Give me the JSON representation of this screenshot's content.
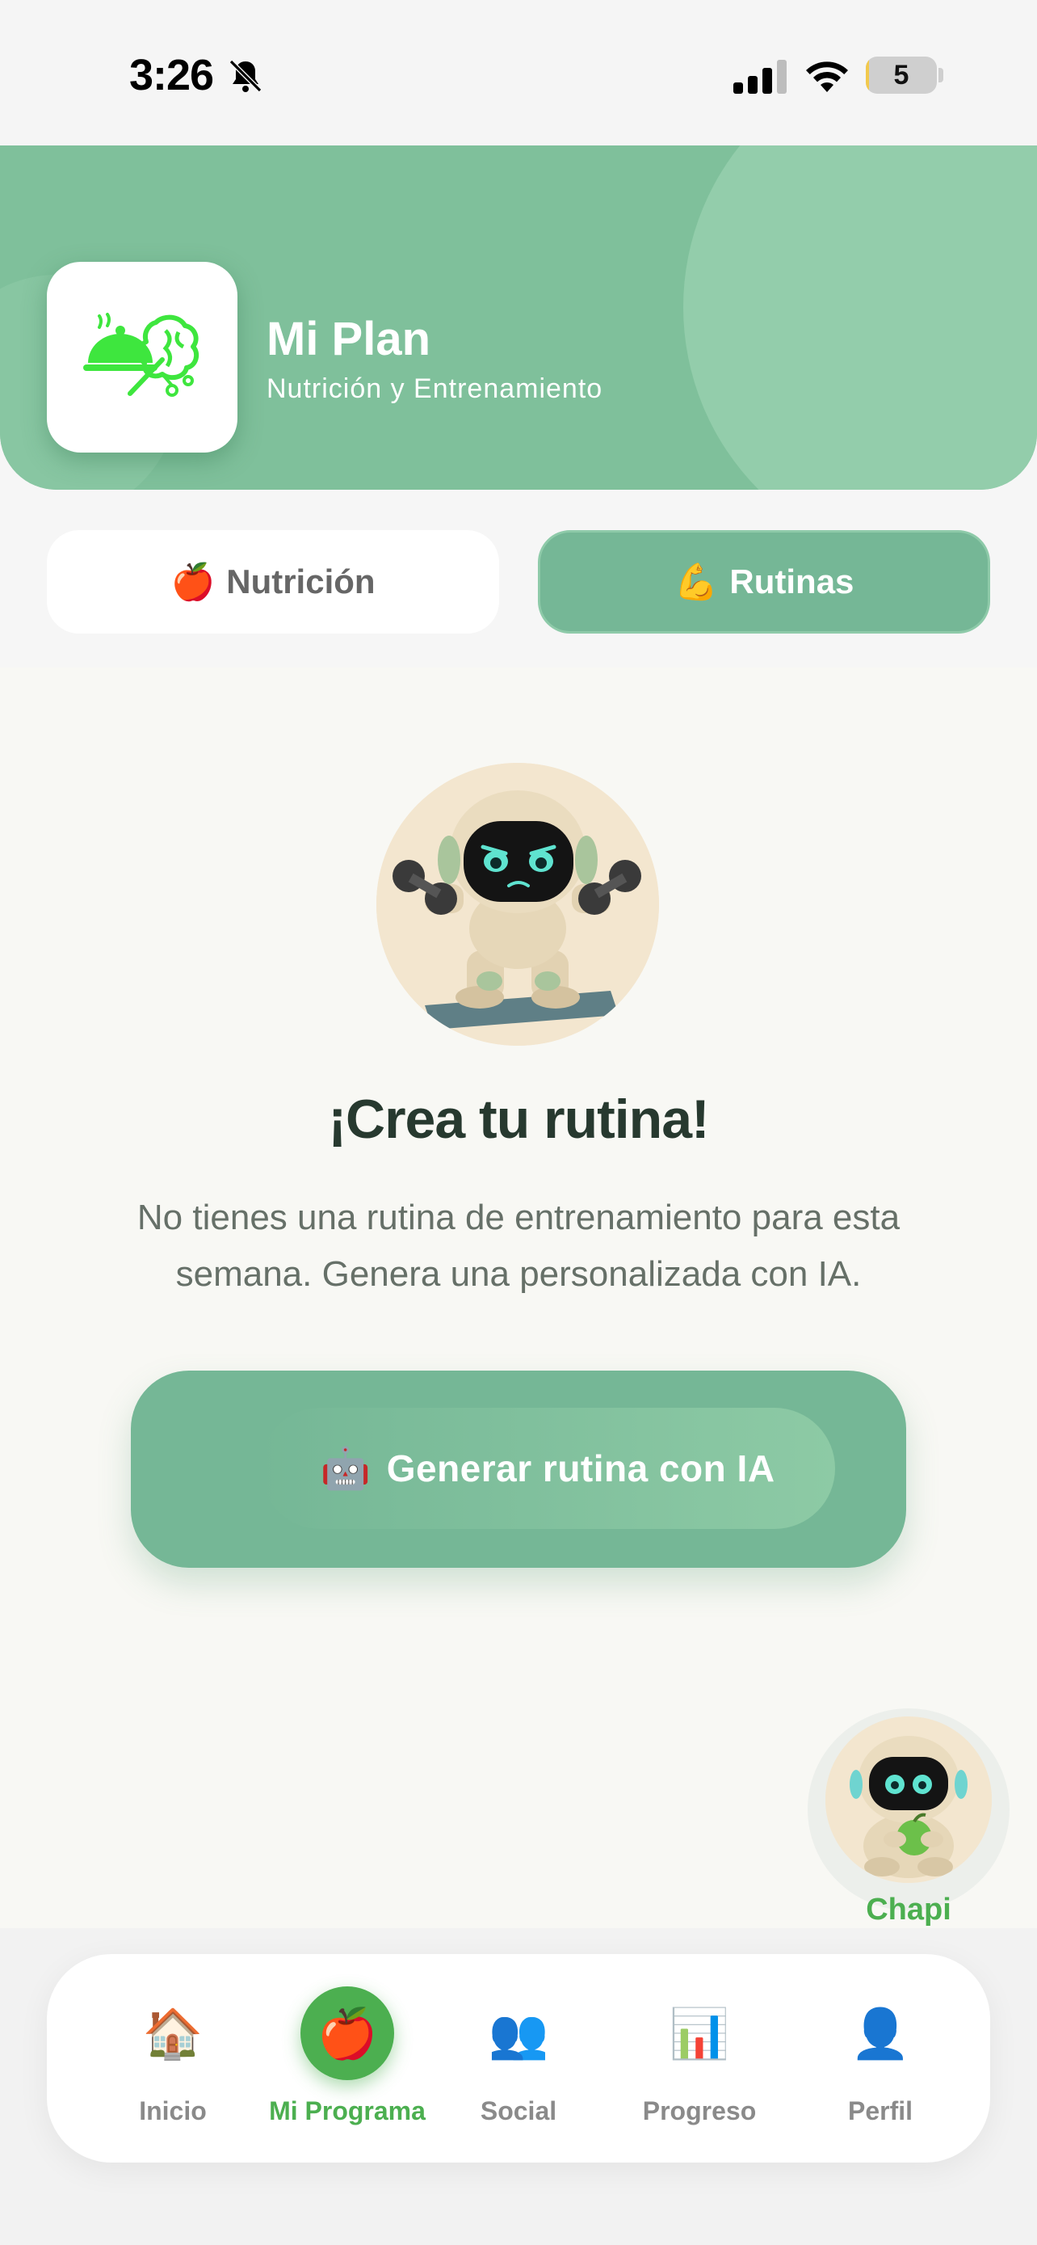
{
  "status_bar": {
    "time": "3:26",
    "battery_level": "5",
    "battery_fraction": 0.05,
    "icons": [
      "bell-off-icon",
      "cellular-signal-icon",
      "wifi-icon",
      "battery-icon"
    ]
  },
  "header": {
    "title": "Mi Plan",
    "subtitle": "Nutrición y Entrenamiento",
    "logo_icon": "food-brain-logo-icon",
    "background_color": "#7fc09b"
  },
  "tabs": [
    {
      "emoji": "🍎",
      "label": "Nutrición",
      "active": false
    },
    {
      "emoji": "💪",
      "label": "Rutinas",
      "active": true
    }
  ],
  "main": {
    "illustration": "robot-dumbbells-illustration",
    "title": "¡Crea tu rutina!",
    "description": "No tienes una rutina de entrenamiento para esta semana. Genera una personalizada con IA.",
    "generate_button": {
      "emoji": "🤖",
      "label": "Generar rutina con IA"
    }
  },
  "assistant": {
    "label": "Chapi",
    "icon": "robot-apple-avatar-icon"
  },
  "bottom_nav": {
    "items": [
      {
        "icon": "🏠",
        "label": "Inicio",
        "active": false
      },
      {
        "icon": "🍎",
        "label": "Mi Programa",
        "active": true
      },
      {
        "icon": "👥",
        "label": "Social",
        "active": false
      },
      {
        "icon": "📊",
        "label": "Progreso",
        "active": false
      },
      {
        "icon": "👤",
        "label": "Perfil",
        "active": false
      }
    ]
  },
  "colors": {
    "accent_green": "#4caf50",
    "header_green": "#7fc09b",
    "button_green": "#75b796",
    "title_dark": "#27392f"
  }
}
